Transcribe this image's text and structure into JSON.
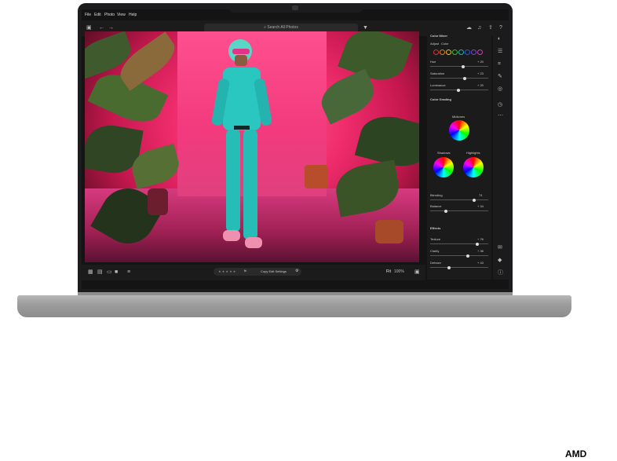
{
  "menu": [
    "File",
    "Edit",
    "Photo",
    "View",
    "Help"
  ],
  "search": {
    "placeholder": "Search All Photos"
  },
  "color_mixer": {
    "title": "Color Mixer",
    "adjust_label": "Adjust",
    "adjust_value": "Color",
    "sliders": [
      {
        "label": "Hue",
        "value": "+ 20"
      },
      {
        "label": "Saturation",
        "value": "+ 23"
      },
      {
        "label": "Luminance",
        "value": "+ 20"
      }
    ],
    "swatch_colors": [
      "#e03030",
      "#e07a20",
      "#e0c020",
      "#30c030",
      "#20b0b0",
      "#3050e0",
      "#8040d0",
      "#d040b0"
    ]
  },
  "color_grading": {
    "title": "Color Grading",
    "midtones": "Midtones",
    "shadows": "Shadows",
    "highlights": "Highlights",
    "sliders": [
      {
        "label": "Blending",
        "value": "74"
      },
      {
        "label": "Balance",
        "value": "+ 34"
      }
    ]
  },
  "effects": {
    "title": "Effects",
    "sliders": [
      {
        "label": "Texture",
        "value": "+ 76"
      },
      {
        "label": "Clarity",
        "value": "+ 36"
      },
      {
        "label": "Dehaze",
        "value": "+ 43"
      }
    ]
  },
  "bottom": {
    "rating": "★ ★ ★ ★ ★",
    "copy_button": "Copy Edit Settings",
    "fit": "Fit",
    "zoom": "100%"
  },
  "brand": "AMD"
}
